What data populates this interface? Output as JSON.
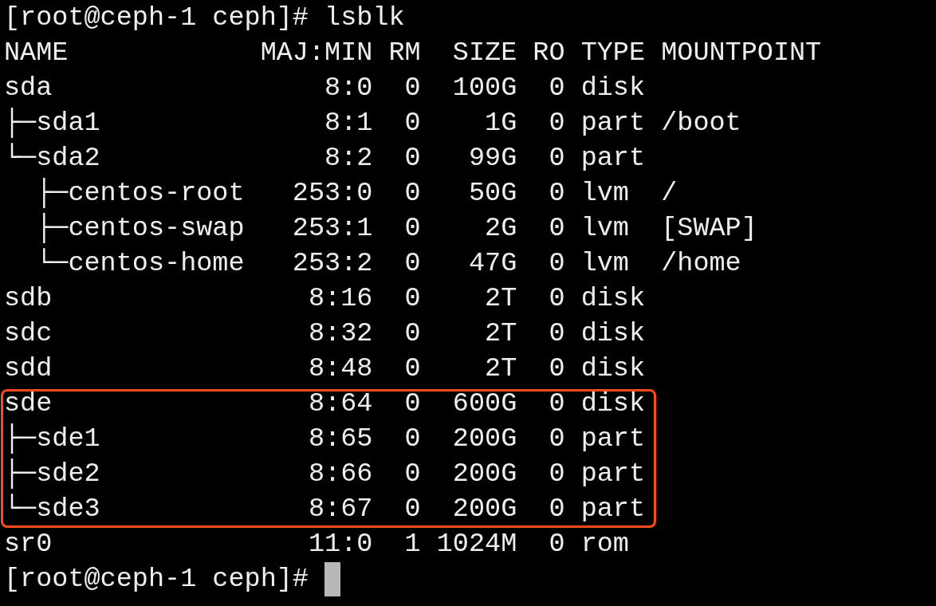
{
  "prompt_line": {
    "prompt": "[root@ceph-1 ceph]#",
    "command": "lsblk"
  },
  "columns": [
    "NAME",
    "MAJ:MIN",
    "RM",
    "SIZE",
    "RO",
    "TYPE",
    "MOUNTPOINT"
  ],
  "rows": [
    {
      "name": "sda",
      "maj_min": "8:0",
      "rm": "0",
      "size": "100G",
      "ro": "0",
      "type": "disk",
      "highlighted": false
    },
    {
      "name": "├─sda1",
      "maj_min": "8:1",
      "rm": "0",
      "size": "1G",
      "ro": "0",
      "type": "part",
      "mountpoint": "/boot",
      "highlighted": false
    },
    {
      "name": "└─sda2",
      "maj_min": "8:2",
      "rm": "0",
      "size": "99G",
      "ro": "0",
      "type": "part",
      "highlighted": false
    },
    {
      "name": "  ├─centos-root",
      "maj_min": "253:0",
      "rm": "0",
      "size": "50G",
      "ro": "0",
      "type": "lvm",
      "mountpoint": "/",
      "highlighted": false
    },
    {
      "name": "  ├─centos-swap",
      "maj_min": "253:1",
      "rm": "0",
      "size": "2G",
      "ro": "0",
      "type": "lvm",
      "mountpoint": "[SWAP]",
      "highlighted": false
    },
    {
      "name": "  └─centos-home",
      "maj_min": "253:2",
      "rm": "0",
      "size": "47G",
      "ro": "0",
      "type": "lvm",
      "mountpoint": "/home",
      "highlighted": false
    },
    {
      "name": "sdb",
      "maj_min": "8:16",
      "rm": "0",
      "size": "2T",
      "ro": "0",
      "type": "disk",
      "highlighted": false
    },
    {
      "name": "sdc",
      "maj_min": "8:32",
      "rm": "0",
      "size": "2T",
      "ro": "0",
      "type": "disk",
      "highlighted": false
    },
    {
      "name": "sdd",
      "maj_min": "8:48",
      "rm": "0",
      "size": "2T",
      "ro": "0",
      "type": "disk",
      "highlighted": false
    },
    {
      "name": "sde",
      "maj_min": "8:64",
      "rm": "0",
      "size": "600G",
      "ro": "0",
      "type": "disk",
      "highlighted": true
    },
    {
      "name": "├─sde1",
      "maj_min": "8:65",
      "rm": "0",
      "size": "200G",
      "ro": "0",
      "type": "part",
      "highlighted": true
    },
    {
      "name": "├─sde2",
      "maj_min": "8:66",
      "rm": "0",
      "size": "200G",
      "ro": "0",
      "type": "part",
      "highlighted": true
    },
    {
      "name": "└─sde3",
      "maj_min": "8:67",
      "rm": "0",
      "size": "200G",
      "ro": "0",
      "type": "part",
      "highlighted": true
    },
    {
      "name": "sr0",
      "maj_min": "11:0",
      "rm": "1",
      "size": "1024M",
      "ro": "0",
      "type": "rom",
      "highlighted": false
    }
  ],
  "final_prompt": {
    "prompt": "[root@ceph-1 ceph]#",
    "cursor": true
  }
}
